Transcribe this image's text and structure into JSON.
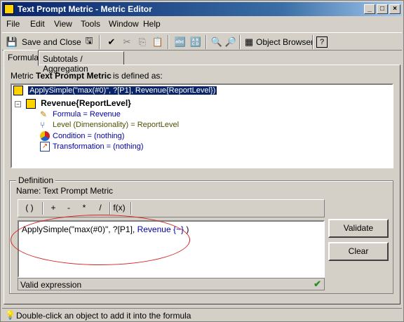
{
  "window": {
    "title": "Text Prompt Metric - Metric Editor"
  },
  "menu": [
    "File",
    "Edit",
    "View",
    "Tools",
    "Window",
    "Help"
  ],
  "toolbar": {
    "save_close": "Save and Close",
    "object_browser": "Object Browser"
  },
  "tabs": [
    "Formula",
    "Subtotals / Aggregation"
  ],
  "header": {
    "prefix": "Metric",
    "name": "Text Prompt Metric",
    "suffix": "is defined as:"
  },
  "tree": {
    "root": "ApplySimple(\"max(#0)\", ?[P1], Revenue{ReportLevel})",
    "child": "Revenue{ReportLevel}",
    "formula": "Formula = Revenue",
    "level": "Level (Dimensionality) = ReportLevel",
    "condition": "Condition = (nothing)",
    "transformation": "Transformation = (nothing)"
  },
  "definition": {
    "group_label": "Definition",
    "name_label": "Name:",
    "name_value": "Text Prompt Metric",
    "ops": [
      "( )",
      "+",
      "-",
      "*",
      "/",
      "f(x)"
    ],
    "formula_black": "ApplySimple(\"max(#0)\", ?[P1],",
    "formula_blue": "Revenue {~}",
    "formula_end": ")",
    "status": "Valid expression"
  },
  "buttons": {
    "validate": "Validate",
    "clear": "Clear"
  },
  "statusbar": "Double-click an object to add it into the formula",
  "colors": {
    "accent": "#0a246a",
    "annotation": "#d42020",
    "valid": "#2e8b2e"
  }
}
